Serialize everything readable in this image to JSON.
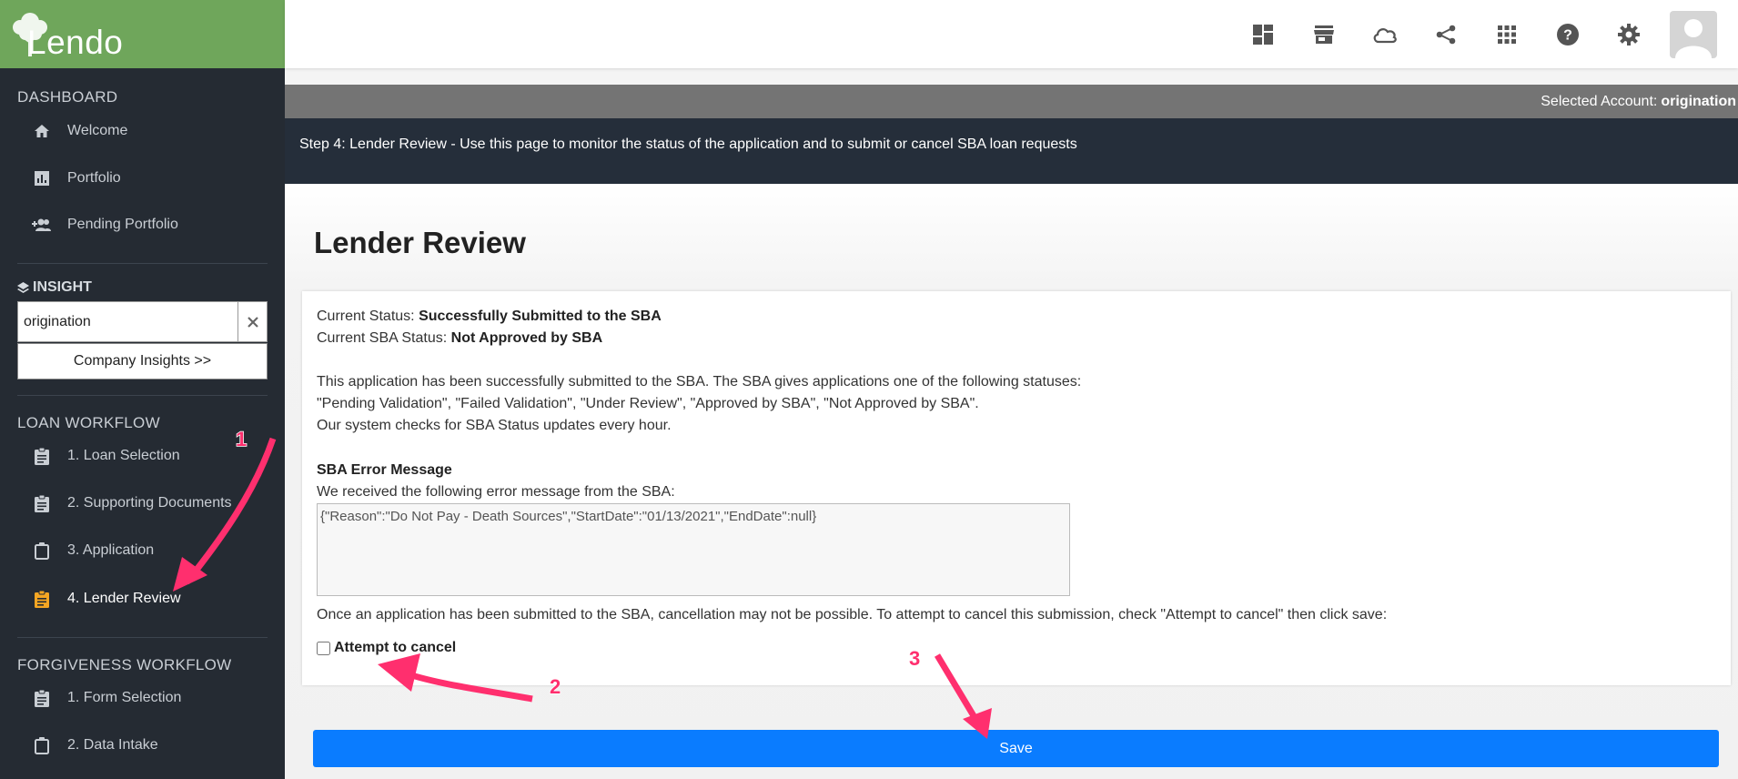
{
  "brand": {
    "logo_text": "Lendo"
  },
  "sidebar": {
    "dashboard_title": "DASHBOARD",
    "dashboard_items": [
      {
        "label": "Welcome",
        "icon": "home-icon"
      },
      {
        "label": "Portfolio",
        "icon": "chart-icon"
      },
      {
        "label": "Pending Portfolio",
        "icon": "people-add-icon"
      }
    ],
    "insight": {
      "title": "INSIGHT",
      "input_value": "origination",
      "button_label": "Company Insights >>"
    },
    "loan_workflow_title": "LOAN WORKFLOW",
    "loan_items": [
      {
        "label": "1. Loan Selection"
      },
      {
        "label": "2. Supporting Documents"
      },
      {
        "label": "3. Application"
      },
      {
        "label": "4. Lender Review",
        "active": true
      }
    ],
    "forgiveness_title": "FORGIVENESS WORKFLOW",
    "forgiveness_items": [
      {
        "label": "1. Form Selection"
      },
      {
        "label": "2. Data Intake"
      }
    ]
  },
  "header": {
    "icons": [
      "dashboard-icon",
      "store-icon",
      "cloud-icon",
      "share-icon",
      "apps-icon",
      "help-icon",
      "settings-icon"
    ],
    "account_label": "Selected Account:",
    "account_value": "origination"
  },
  "step_text": "Step 4: Lender Review - Use this page to monitor the status of the application and to submit or cancel SBA loan requests",
  "page": {
    "title": "Lender Review",
    "status_label": "Current Status:",
    "status_value": "Successfully Submitted to the SBA",
    "sba_status_label": "Current SBA Status:",
    "sba_status_value": "Not Approved by SBA",
    "info_line1": "This application has been successfully submitted to the SBA. The SBA gives applications one of the following statuses:",
    "info_line2": "\"Pending Validation\", \"Failed Validation\", \"Under Review\", \"Approved by SBA\", \"Not Approved by SBA\".",
    "info_line3": "Our system checks for SBA Status updates every hour.",
    "error_title": "SBA Error Message",
    "error_intro": "We received the following error message from the SBA:",
    "error_message": "{\"Reason\":\"Do Not Pay - Death Sources\",\"StartDate\":\"01/13/2021\",\"EndDate\":null}",
    "cancel_note": "Once an application has been submitted to the SBA, cancellation may not be possible. To attempt to cancel this submission, check \"Attempt to cancel\" then click save:",
    "cancel_label": "Attempt to cancel",
    "save_label": "Save"
  },
  "annotations": {
    "n1": "1",
    "n2": "2",
    "n3": "3",
    "color": "#ff2f6e"
  },
  "colors": {
    "sidebar": "#252b33",
    "brand": "#6fa65b",
    "accent": "#0a7cff",
    "active_icon": "#f5a623"
  }
}
